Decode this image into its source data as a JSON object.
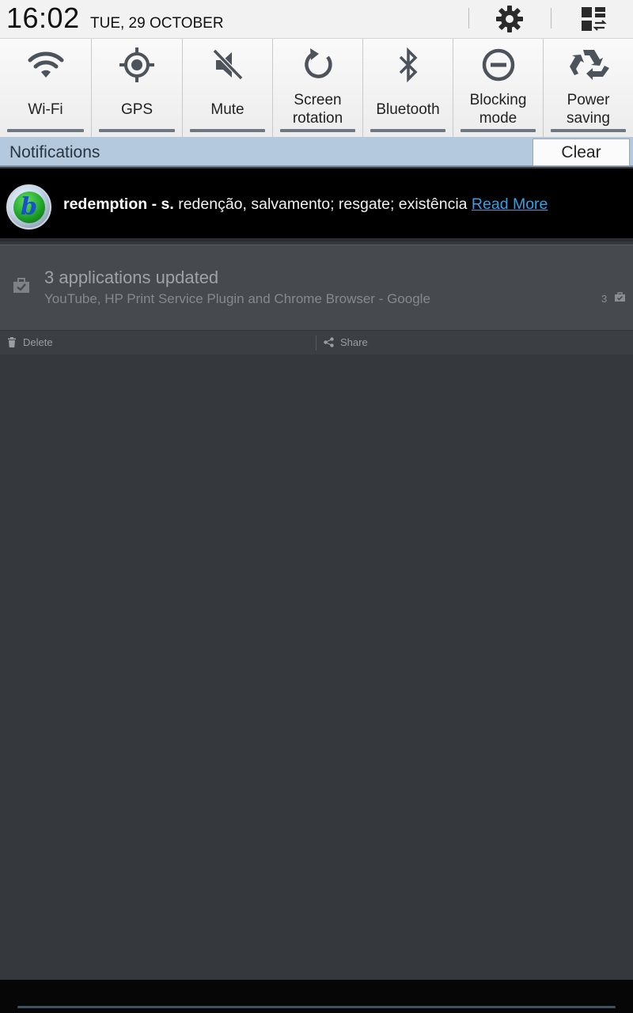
{
  "header": {
    "time": "16:02",
    "date": "TUE, 29 OCTOBER",
    "settings_icon": "gear-icon",
    "multiwindow_icon": "grid-switch-icon"
  },
  "quick_toggles": [
    {
      "label": "Wi-Fi",
      "icon": "wifi-icon",
      "active": false
    },
    {
      "label": "GPS",
      "icon": "gps-icon",
      "active": false
    },
    {
      "label": "Mute",
      "icon": "mute-icon",
      "active": false
    },
    {
      "label": "Screen\nrotation",
      "icon": "rotation-icon",
      "active": false
    },
    {
      "label": "Bluetooth",
      "icon": "bluetooth-icon",
      "active": false
    },
    {
      "label": "Blocking\nmode",
      "icon": "blocking-icon",
      "active": false
    },
    {
      "label": "Power\nsaving",
      "icon": "recycle-icon",
      "active": false
    }
  ],
  "notifications": {
    "title": "Notifications",
    "clear_label": "Clear",
    "dictionary": {
      "word": "redemption",
      "pos": " - s.",
      "definition": " redenção, salvamento; resgate; existência ",
      "link": "Read More"
    },
    "apps_updated": {
      "title": "3 applications updated",
      "detail": "YouTube, HP Print Service Plugin and Chrome Browser - Google",
      "count": "3",
      "actions": {
        "delete": "Delete",
        "share": "Share"
      }
    }
  },
  "colors": {
    "accent_link": "#33a2e8",
    "notif_header": "#b4c9dd",
    "background": "#35383d"
  }
}
